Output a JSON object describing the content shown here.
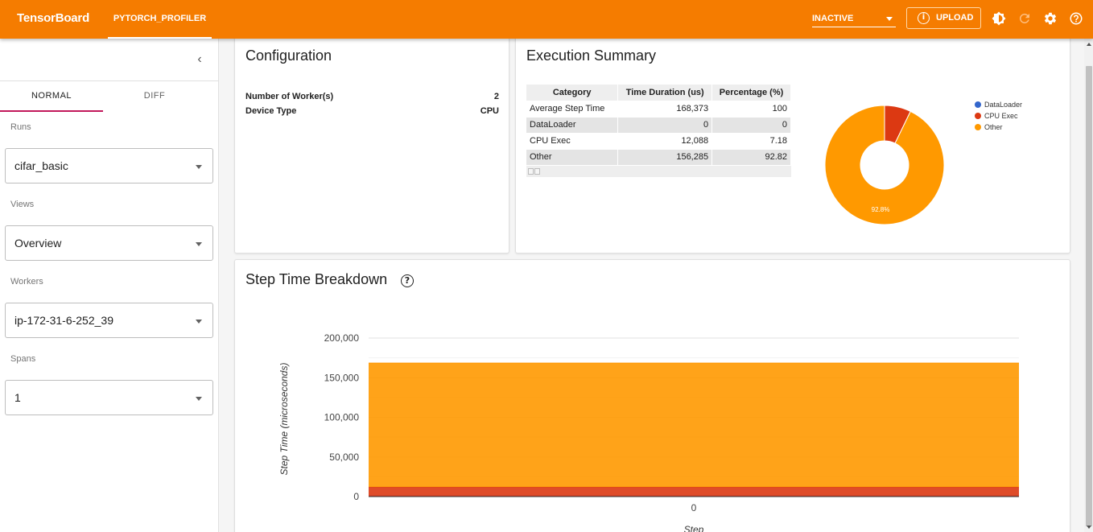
{
  "header": {
    "brand": "TensorBoard",
    "active_plugin": "PYTORCH_PROFILER",
    "status_select": "INACTIVE",
    "upload_label": "UPLOAD",
    "icons": [
      "info-icon",
      "theme-icon",
      "reload-icon",
      "settings-icon",
      "help-icon"
    ],
    "colors": {
      "bar": "#f57c00"
    }
  },
  "sidebar": {
    "collapse_icon": "chevron-left-icon",
    "tabs": [
      {
        "label": "NORMAL",
        "active": true
      },
      {
        "label": "DIFF",
        "active": false
      }
    ],
    "runs": {
      "label": "Runs",
      "value": "cifar_basic"
    },
    "views": {
      "label": "Views",
      "value": "Overview"
    },
    "workers": {
      "label": "Workers",
      "value": "ip-172-31-6-252_39"
    },
    "spans": {
      "label": "Spans",
      "value": "1"
    }
  },
  "configuration": {
    "title": "Configuration",
    "rows": [
      {
        "key": "Number of Worker(s)",
        "value": "2"
      },
      {
        "key": "Device Type",
        "value": "CPU"
      }
    ]
  },
  "execution_summary": {
    "title": "Execution Summary",
    "columns": [
      "Category",
      "Time Duration (us)",
      "Percentage (%)"
    ],
    "rows": [
      [
        "Average Step Time",
        "168,373",
        "100"
      ],
      [
        "DataLoader",
        "0",
        "0"
      ],
      [
        "CPU Exec",
        "12,088",
        "7.18"
      ],
      [
        "Other",
        "156,285",
        "92.82"
      ]
    ]
  },
  "step_time": {
    "title": "Step Time Breakdown"
  },
  "chart_data": [
    {
      "type": "pie",
      "donut": true,
      "labels": [
        "DataLoader",
        "CPU Exec",
        "Other"
      ],
      "values": [
        0,
        7.18,
        92.82
      ],
      "colors": [
        "#3366cc",
        "#dc3912",
        "#ff9900"
      ],
      "slice_label": "92.8%",
      "legend": "right"
    },
    {
      "type": "area",
      "stacked": true,
      "xlabel": "Step",
      "ylabel": "Step Time (microseconds)",
      "categories": [
        "0"
      ],
      "ylim": [
        0,
        200000
      ],
      "yticks": [
        "0",
        "50,000",
        "100,000",
        "150,000",
        "200,000"
      ],
      "series": [
        {
          "name": "DataLoader",
          "values": [
            0
          ],
          "color": "#3366cc"
        },
        {
          "name": "CPU Exec",
          "values": [
            12088
          ],
          "color": "#dc3912"
        },
        {
          "name": "Other",
          "values": [
            156285
          ],
          "color": "#ff9900"
        }
      ]
    }
  ]
}
